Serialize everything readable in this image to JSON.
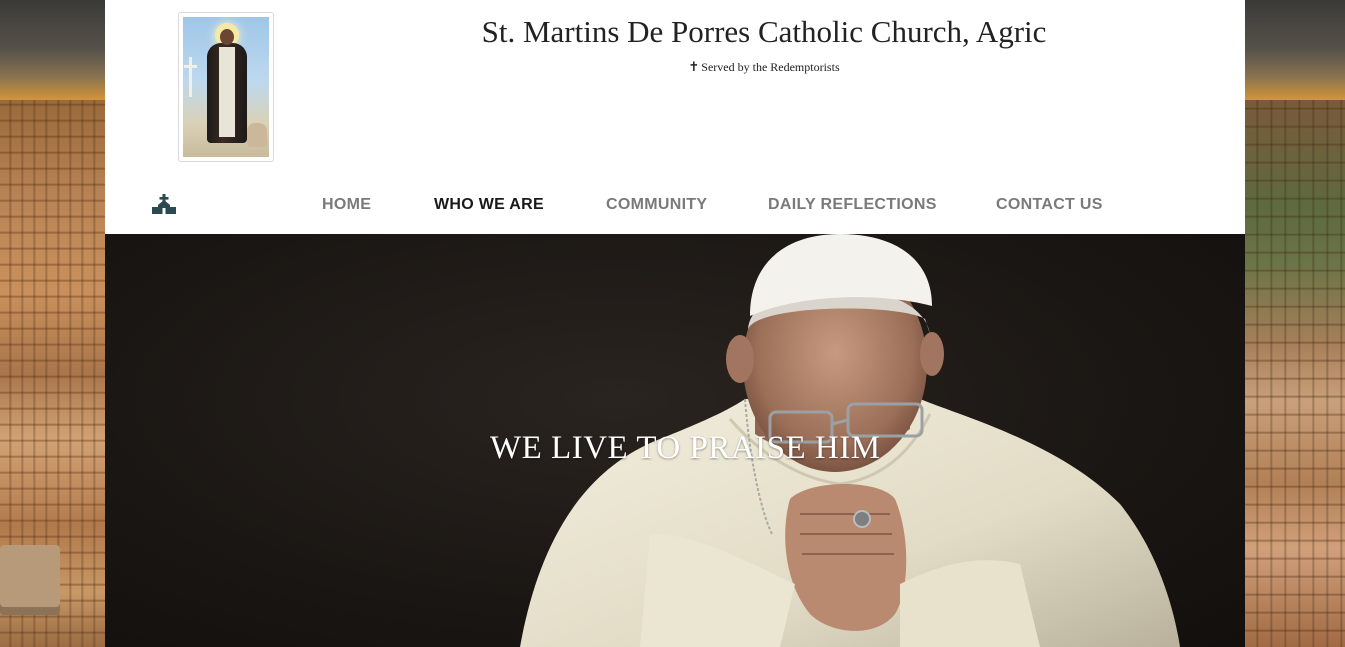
{
  "site": {
    "title": "St. Martins De Porres Catholic Church, Agric",
    "tagline_icon": "cross-icon",
    "tagline": "Served by the Redemptorists"
  },
  "nav": {
    "home_icon": "church-icon",
    "items": [
      {
        "label": "HOME",
        "active": false
      },
      {
        "label": "WHO WE ARE",
        "active": true
      },
      {
        "label": "COMMUNITY",
        "active": false
      },
      {
        "label": "DAILY REFLECTIONS",
        "active": false
      },
      {
        "label": "CONTACT US",
        "active": false
      }
    ]
  },
  "hero": {
    "text": "WE LIVE TO PRAISE HIM"
  },
  "colors": {
    "nav_inactive": "#7a7a7a",
    "nav_active": "#1a1a1a",
    "hero_bg": "#1a1613",
    "home_icon": "#2c4a52"
  }
}
